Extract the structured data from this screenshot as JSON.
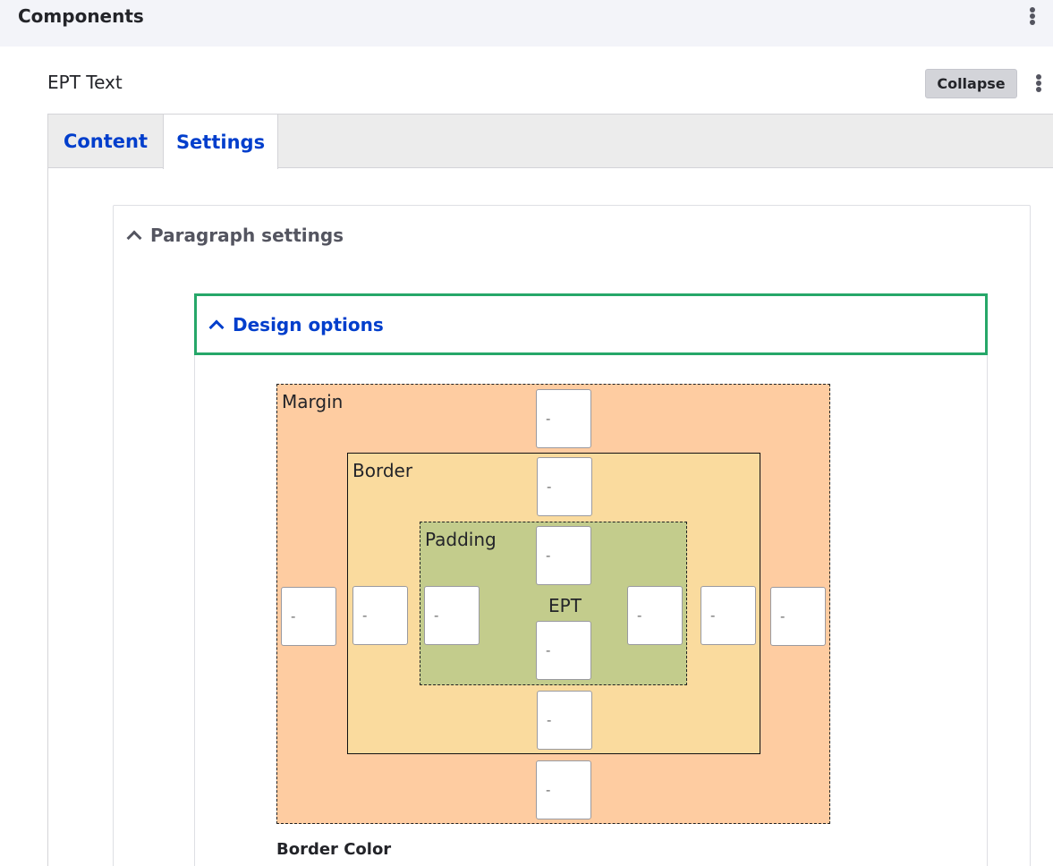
{
  "topbar": {
    "title": "Components"
  },
  "item": {
    "title": "EPT Text",
    "collapse_label": "Collapse"
  },
  "tabs": [
    {
      "label": "Content"
    },
    {
      "label": "Settings"
    }
  ],
  "paragraph_settings": {
    "label": "Paragraph settings"
  },
  "design_options": {
    "label": "Design options",
    "box_labels": {
      "margin": "Margin",
      "border": "Border",
      "padding": "Padding",
      "content": "EPT"
    },
    "margin": {
      "top": "-",
      "right": "-",
      "bottom": "-",
      "left": "-"
    },
    "border": {
      "top": "-",
      "right": "-",
      "bottom": "-",
      "left": "-"
    },
    "padding": {
      "top": "-",
      "right": "-",
      "bottom": "-",
      "left": "-"
    },
    "border_color_label": "Border Color"
  },
  "colors": {
    "accent_blue": "#003ecc",
    "focus_green": "#26a769",
    "margin_fill": "#fecca1",
    "border_fill": "#fadb9e",
    "padding_fill": "#c3cc8c"
  }
}
